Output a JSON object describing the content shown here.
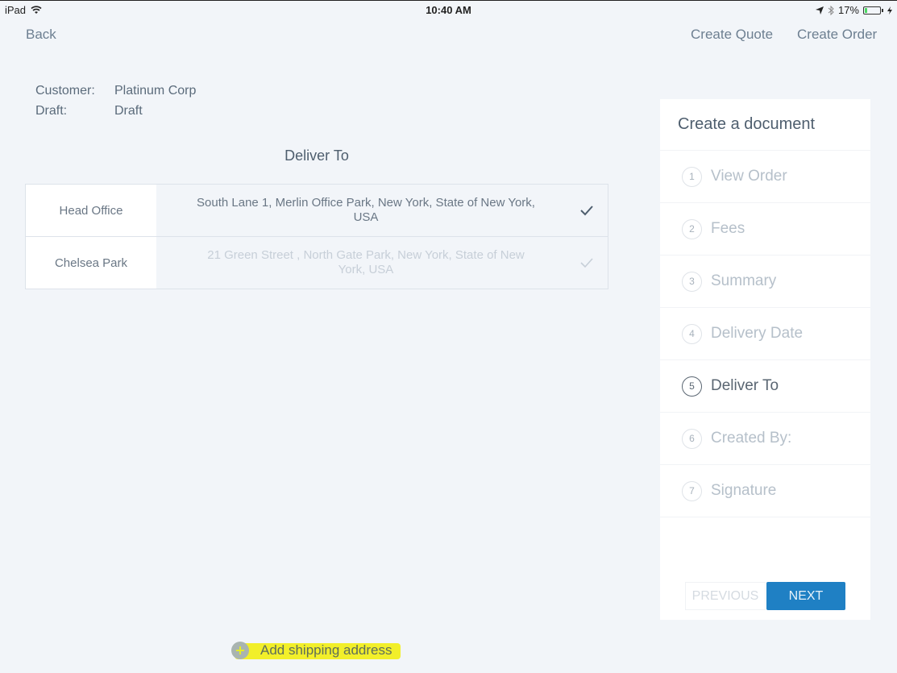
{
  "status_bar": {
    "device": "iPad",
    "time": "10:40 AM",
    "battery_percent": "17%",
    "battery_level": 0.17,
    "icons": [
      "wifi-icon",
      "location-icon",
      "bluetooth-icon",
      "battery-icon",
      "charging-icon"
    ]
  },
  "nav": {
    "back_label": "Back",
    "create_quote_label": "Create Quote",
    "create_order_label": "Create Order"
  },
  "meta": {
    "customer_label": "Customer:",
    "customer_value": "Platinum Corp",
    "draft_label": "Draft:",
    "draft_value": "Draft"
  },
  "section": {
    "title": "Deliver To"
  },
  "addresses": [
    {
      "name": "Head Office",
      "address": "South Lane 1, Merlin Office Park, New York, State of New York, USA",
      "selected": true
    },
    {
      "name": "Chelsea Park",
      "address": "21 Green Street , North Gate Park, New York, State of New York, USA",
      "selected": false
    }
  ],
  "wizard": {
    "title": "Create a document",
    "steps": [
      {
        "num": "1",
        "label": "View Order"
      },
      {
        "num": "2",
        "label": "Fees"
      },
      {
        "num": "3",
        "label": "Summary"
      },
      {
        "num": "4",
        "label": "Delivery Date"
      },
      {
        "num": "5",
        "label": "Deliver To"
      },
      {
        "num": "6",
        "label": "Created By:"
      },
      {
        "num": "7",
        "label": "Signature"
      }
    ],
    "active_step": 5,
    "previous_label": "PREVIOUS",
    "next_label": "NEXT"
  },
  "add_shipping": {
    "label": "Add shipping address",
    "highlight_color": "#f2ef2a"
  },
  "colors": {
    "primary": "#1f80c4",
    "background": "#f2f5f9"
  }
}
